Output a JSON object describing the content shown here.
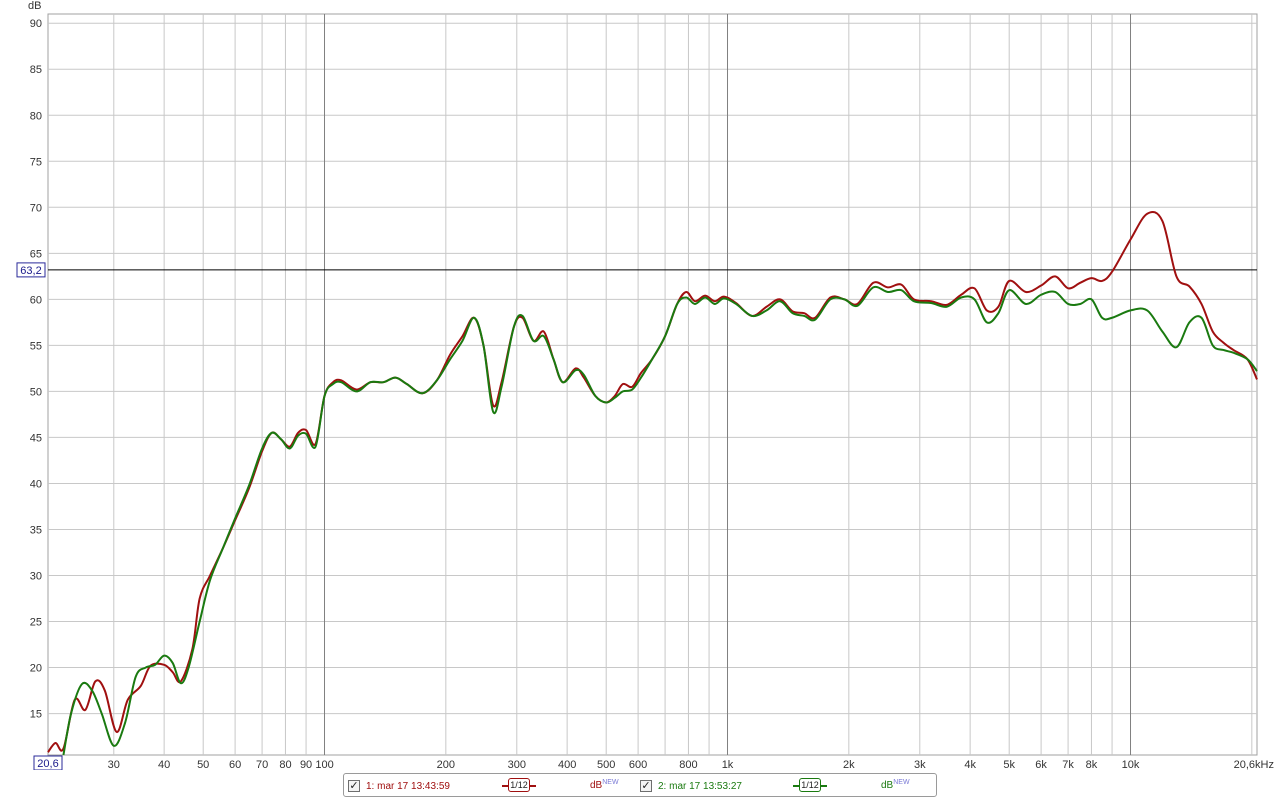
{
  "chart_data": {
    "type": "line",
    "x_scale": "log",
    "x_unit": "kHz",
    "y_unit": "dB",
    "xlim": [
      20.6,
      20600
    ],
    "ylim": [
      10.5,
      91
    ],
    "x_ticks": [
      {
        "value": 30,
        "label": "30"
      },
      {
        "value": 40,
        "label": "40"
      },
      {
        "value": 50,
        "label": "50"
      },
      {
        "value": 60,
        "label": "60"
      },
      {
        "value": 70,
        "label": "70"
      },
      {
        "value": 80,
        "label": "80"
      },
      {
        "value": 90,
        "label": "90"
      },
      {
        "value": 100,
        "label": "100"
      },
      {
        "value": 200,
        "label": "200"
      },
      {
        "value": 300,
        "label": "300"
      },
      {
        "value": 400,
        "label": "400"
      },
      {
        "value": 500,
        "label": "500"
      },
      {
        "value": 600,
        "label": "600"
      },
      {
        "value": 800,
        "label": "800"
      },
      {
        "value": 1000,
        "label": "1k"
      },
      {
        "value": 2000,
        "label": "2k"
      },
      {
        "value": 3000,
        "label": "3k"
      },
      {
        "value": 4000,
        "label": "4k"
      },
      {
        "value": 5000,
        "label": "5k"
      },
      {
        "value": 6000,
        "label": "6k"
      },
      {
        "value": 7000,
        "label": "7k"
      },
      {
        "value": 8000,
        "label": "8k"
      },
      {
        "value": 10000,
        "label": "10k"
      },
      {
        "value": 20600,
        "label": "20,6kHz"
      }
    ],
    "x_grid_minor": [
      60,
      70,
      80,
      90,
      600,
      700,
      800,
      900,
      6000,
      7000,
      8000,
      9000
    ],
    "x_grid_major": [
      100,
      1000,
      10000
    ],
    "y_ticks": [
      15,
      20,
      25,
      30,
      35,
      40,
      45,
      50,
      55,
      60,
      65,
      70,
      75,
      80,
      85,
      90
    ],
    "x_min_label": "20,6",
    "cursor": {
      "y": 63.2,
      "label": "63,2"
    },
    "grid": true,
    "legend_position": "bottom-center",
    "series": [
      {
        "name": "1: mar 17 13:43:59",
        "color": "#a01010",
        "points": [
          [
            20.6,
            10.8
          ],
          [
            21.5,
            11.8
          ],
          [
            22.5,
            11.2
          ],
          [
            24,
            16.5
          ],
          [
            25.5,
            15.4
          ],
          [
            27,
            18.5
          ],
          [
            28.5,
            17.5
          ],
          [
            30.5,
            13
          ],
          [
            32.5,
            16.5
          ],
          [
            35,
            18
          ],
          [
            37,
            20.2
          ],
          [
            40,
            20.3
          ],
          [
            42,
            19.5
          ],
          [
            44,
            18.5
          ],
          [
            47,
            22
          ],
          [
            49,
            27.5
          ],
          [
            52,
            30
          ],
          [
            56,
            33
          ],
          [
            60,
            36
          ],
          [
            65,
            39.5
          ],
          [
            70,
            43.5
          ],
          [
            74,
            45.5
          ],
          [
            78,
            44.8
          ],
          [
            82,
            44
          ],
          [
            86,
            45.5
          ],
          [
            90,
            45.8
          ],
          [
            95,
            44.3
          ],
          [
            100,
            49.5
          ],
          [
            105,
            51
          ],
          [
            110,
            51.2
          ],
          [
            120,
            50.2
          ],
          [
            130,
            51
          ],
          [
            140,
            51
          ],
          [
            150,
            51.5
          ],
          [
            160,
            50.8
          ],
          [
            175,
            49.8
          ],
          [
            190,
            51.2
          ],
          [
            205,
            54
          ],
          [
            220,
            56
          ],
          [
            235,
            58
          ],
          [
            248,
            55
          ],
          [
            262,
            48.5
          ],
          [
            275,
            51
          ],
          [
            295,
            57
          ],
          [
            310,
            58
          ],
          [
            330,
            55.5
          ],
          [
            350,
            56.5
          ],
          [
            370,
            53.5
          ],
          [
            390,
            51
          ],
          [
            420,
            52.5
          ],
          [
            440,
            51.5
          ],
          [
            470,
            49.5
          ],
          [
            500,
            48.8
          ],
          [
            525,
            49.5
          ],
          [
            550,
            50.8
          ],
          [
            580,
            50.5
          ],
          [
            610,
            52
          ],
          [
            650,
            53.5
          ],
          [
            700,
            56
          ],
          [
            750,
            59.5
          ],
          [
            790,
            60.8
          ],
          [
            830,
            59.8
          ],
          [
            880,
            60.4
          ],
          [
            930,
            59.8
          ],
          [
            980,
            60.3
          ],
          [
            1050,
            59.6
          ],
          [
            1150,
            58.2
          ],
          [
            1250,
            59.2
          ],
          [
            1350,
            60
          ],
          [
            1450,
            58.7
          ],
          [
            1550,
            58.5
          ],
          [
            1650,
            58
          ],
          [
            1800,
            60.2
          ],
          [
            1950,
            60
          ],
          [
            2100,
            59.5
          ],
          [
            2300,
            61.8
          ],
          [
            2500,
            61.3
          ],
          [
            2700,
            61.6
          ],
          [
            2900,
            60
          ],
          [
            3200,
            59.8
          ],
          [
            3500,
            59.4
          ],
          [
            3800,
            60.5
          ],
          [
            4100,
            61.2
          ],
          [
            4400,
            58.8
          ],
          [
            4700,
            59.2
          ],
          [
            5000,
            62
          ],
          [
            5500,
            60.8
          ],
          [
            6000,
            61.5
          ],
          [
            6500,
            62.5
          ],
          [
            7000,
            61.2
          ],
          [
            7500,
            61.8
          ],
          [
            8000,
            62.3
          ],
          [
            8500,
            62
          ],
          [
            9000,
            63
          ],
          [
            10000,
            66.5
          ],
          [
            11000,
            69.3
          ],
          [
            12000,
            68.5
          ],
          [
            13000,
            62.5
          ],
          [
            14000,
            61.4
          ],
          [
            15000,
            59.5
          ],
          [
            16000,
            56.5
          ],
          [
            17000,
            55.3
          ],
          [
            18000,
            54.5
          ],
          [
            19500,
            53.5
          ],
          [
            20600,
            51.3
          ]
        ]
      },
      {
        "name": "2: mar 17 13:53:27",
        "color": "#1a7a10",
        "points": [
          [
            22.5,
            10.5
          ],
          [
            23.5,
            15
          ],
          [
            25,
            18.2
          ],
          [
            26.5,
            17.5
          ],
          [
            28,
            15
          ],
          [
            30,
            11.5
          ],
          [
            32,
            14
          ],
          [
            34,
            19
          ],
          [
            36,
            20
          ],
          [
            38,
            20.3
          ],
          [
            40,
            21.3
          ],
          [
            42,
            20.5
          ],
          [
            44,
            18.3
          ],
          [
            46,
            20
          ],
          [
            49,
            25
          ],
          [
            52,
            29.5
          ],
          [
            56,
            33
          ],
          [
            60,
            36.2
          ],
          [
            65,
            39.8
          ],
          [
            70,
            43.8
          ],
          [
            74,
            45.5
          ],
          [
            78,
            44.8
          ],
          [
            82,
            43.8
          ],
          [
            86,
            45.2
          ],
          [
            90,
            45.4
          ],
          [
            95,
            44
          ],
          [
            100,
            49.5
          ],
          [
            105,
            50.8
          ],
          [
            110,
            51
          ],
          [
            120,
            50
          ],
          [
            130,
            51
          ],
          [
            140,
            51
          ],
          [
            150,
            51.5
          ],
          [
            160,
            50.8
          ],
          [
            175,
            49.8
          ],
          [
            190,
            51.2
          ],
          [
            205,
            53.5
          ],
          [
            220,
            55.5
          ],
          [
            235,
            58
          ],
          [
            248,
            55
          ],
          [
            262,
            47.8
          ],
          [
            275,
            50.5
          ],
          [
            295,
            57
          ],
          [
            310,
            58.2
          ],
          [
            330,
            55.5
          ],
          [
            350,
            56
          ],
          [
            370,
            53.5
          ],
          [
            390,
            51
          ],
          [
            420,
            52.3
          ],
          [
            440,
            51.8
          ],
          [
            470,
            49.5
          ],
          [
            500,
            48.8
          ],
          [
            525,
            49.3
          ],
          [
            550,
            50
          ],
          [
            580,
            50.2
          ],
          [
            610,
            51.5
          ],
          [
            650,
            53.5
          ],
          [
            700,
            56
          ],
          [
            750,
            59.5
          ],
          [
            790,
            60.2
          ],
          [
            830,
            59.5
          ],
          [
            880,
            60.2
          ],
          [
            930,
            59.5
          ],
          [
            980,
            60.1
          ],
          [
            1050,
            59.5
          ],
          [
            1150,
            58.2
          ],
          [
            1250,
            58.8
          ],
          [
            1350,
            59.8
          ],
          [
            1450,
            58.5
          ],
          [
            1550,
            58.2
          ],
          [
            1650,
            57.8
          ],
          [
            1800,
            60
          ],
          [
            1950,
            60
          ],
          [
            2100,
            59.3
          ],
          [
            2300,
            61.3
          ],
          [
            2500,
            60.8
          ],
          [
            2700,
            61
          ],
          [
            2900,
            59.8
          ],
          [
            3200,
            59.6
          ],
          [
            3500,
            59.2
          ],
          [
            3800,
            60.2
          ],
          [
            4100,
            60
          ],
          [
            4400,
            57.5
          ],
          [
            4700,
            58.5
          ],
          [
            5000,
            61
          ],
          [
            5500,
            59.5
          ],
          [
            6000,
            60.5
          ],
          [
            6500,
            60.8
          ],
          [
            7000,
            59.5
          ],
          [
            7500,
            59.5
          ],
          [
            8000,
            60
          ],
          [
            8500,
            58
          ],
          [
            9000,
            58
          ],
          [
            10000,
            58.8
          ],
          [
            11000,
            58.8
          ],
          [
            12000,
            56.5
          ],
          [
            13000,
            54.8
          ],
          [
            14000,
            57.5
          ],
          [
            15000,
            58
          ],
          [
            16000,
            55
          ],
          [
            17000,
            54.5
          ],
          [
            18000,
            54.2
          ],
          [
            19500,
            53.5
          ],
          [
            20600,
            52.2
          ]
        ]
      }
    ]
  },
  "legend": {
    "items": [
      {
        "label": "1: mar 17 13:43:59",
        "smoothing": "1/12",
        "unit": "dB",
        "unit_sup": "NEW",
        "color": "#a01010"
      },
      {
        "label": "2: mar 17 13:53:27",
        "smoothing": "1/12",
        "unit": "dB",
        "unit_sup": "NEW",
        "color": "#1a7a10"
      }
    ]
  }
}
